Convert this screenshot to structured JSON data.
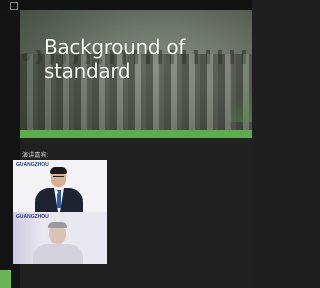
{
  "slide": {
    "title_line1": "Background of",
    "title_line2": "standard"
  },
  "speakers": {
    "label": "演讲嘉宾:",
    "tiles": [
      {
        "logo_text": "GUANGZHOU",
        "logo_sub": "",
        "name_tag": ""
      },
      {
        "logo_text": "GUANGZHOU",
        "logo_sub": "",
        "name_tag": ""
      }
    ]
  },
  "colors": {
    "slide_accent": "#5cad4b",
    "background": "#202020"
  }
}
